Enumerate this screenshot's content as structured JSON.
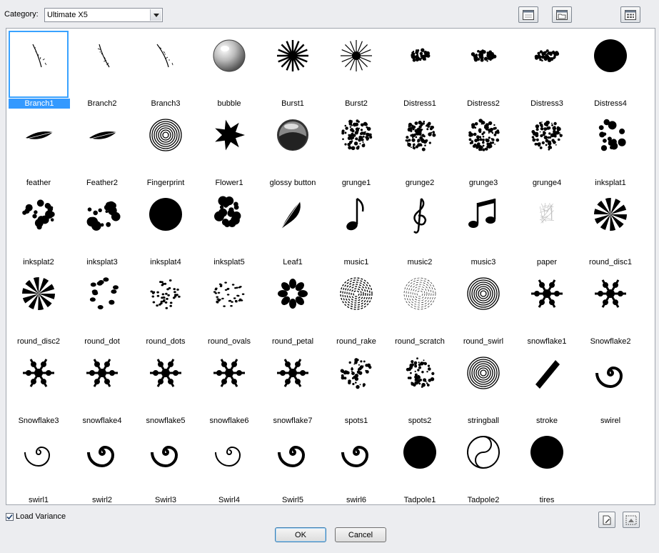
{
  "toolbar": {
    "category_label": "Category:",
    "category_value": "Ultimate X5"
  },
  "grid": {
    "items": [
      {
        "label": "Branch1",
        "icon": "branch-icon",
        "selected": true
      },
      {
        "label": "Branch2",
        "icon": "branch-icon"
      },
      {
        "label": "Branch3",
        "icon": "branch-icon"
      },
      {
        "label": "bubble",
        "icon": "bubble-icon"
      },
      {
        "label": "Burst1",
        "icon": "burst-icon"
      },
      {
        "label": "Burst2",
        "icon": "burst-icon"
      },
      {
        "label": "Distress1",
        "icon": "distress-icon"
      },
      {
        "label": "Distress2",
        "icon": "distress-icon"
      },
      {
        "label": "Distress3",
        "icon": "distress-icon"
      },
      {
        "label": "Distress4",
        "icon": "disc-icon"
      },
      {
        "label": "feather",
        "icon": "feather-icon"
      },
      {
        "label": "Feather2",
        "icon": "feather-icon"
      },
      {
        "label": "Fingerprint",
        "icon": "fingerprint-icon"
      },
      {
        "label": "Flower1",
        "icon": "star-icon"
      },
      {
        "label": "glossy button",
        "icon": "glossy-button-icon"
      },
      {
        "label": "grunge1",
        "icon": "grunge-icon"
      },
      {
        "label": "grunge2",
        "icon": "grunge-icon"
      },
      {
        "label": "grunge3",
        "icon": "grunge-icon"
      },
      {
        "label": "grunge4",
        "icon": "grunge-icon"
      },
      {
        "label": "inksplat1",
        "icon": "inksplat-icon"
      },
      {
        "label": "inksplat2",
        "icon": "inksplat-icon"
      },
      {
        "label": "inksplat3",
        "icon": "inksplat-icon"
      },
      {
        "label": "inksplat4",
        "icon": "disc-icon"
      },
      {
        "label": "inksplat5",
        "icon": "inksplat-icon"
      },
      {
        "label": "Leaf1",
        "icon": "leaf-icon"
      },
      {
        "label": "music1",
        "icon": "music-note-icon"
      },
      {
        "label": "music2",
        "icon": "treble-clef-icon"
      },
      {
        "label": "music3",
        "icon": "music-notes-icon"
      },
      {
        "label": "paper",
        "icon": "paper-icon"
      },
      {
        "label": "round_disc1",
        "icon": "round-disc-icon"
      },
      {
        "label": "round_disc2",
        "icon": "round-disc-icon"
      },
      {
        "label": "round_dot",
        "icon": "round-dot-icon"
      },
      {
        "label": "round_dots",
        "icon": "round-dots-icon"
      },
      {
        "label": "round_ovals",
        "icon": "round-ovals-icon"
      },
      {
        "label": "round_petal",
        "icon": "round-petal-icon"
      },
      {
        "label": "round_rake",
        "icon": "round-rake-icon"
      },
      {
        "label": "round_scratch",
        "icon": "round-scratch-icon"
      },
      {
        "label": "round_swirl",
        "icon": "round-swirl-icon"
      },
      {
        "label": "snowflake1",
        "icon": "snowflake-icon"
      },
      {
        "label": "Snowflake2",
        "icon": "snowflake-icon"
      },
      {
        "label": "Snowflake3",
        "icon": "snowflake-icon"
      },
      {
        "label": "snowflake4",
        "icon": "snowflake-icon"
      },
      {
        "label": "snowflake5",
        "icon": "snowflake-icon"
      },
      {
        "label": "snowflake6",
        "icon": "snowflake-icon"
      },
      {
        "label": "snowflake7",
        "icon": "snowflake-icon"
      },
      {
        "label": "spots1",
        "icon": "spots-icon"
      },
      {
        "label": "spots2",
        "icon": "spots-icon"
      },
      {
        "label": "stringball",
        "icon": "stringball-icon"
      },
      {
        "label": "stroke",
        "icon": "stroke-icon"
      },
      {
        "label": "swirel",
        "icon": "swirl-icon"
      },
      {
        "label": "swirl1",
        "icon": "swirl-icon"
      },
      {
        "label": "swirl2",
        "icon": "swirl-icon"
      },
      {
        "label": "Swirl3",
        "icon": "swirl-icon"
      },
      {
        "label": "Swirl4",
        "icon": "swirl-icon"
      },
      {
        "label": "Swirl5",
        "icon": "swirl-icon"
      },
      {
        "label": "swirl6",
        "icon": "swirl-icon"
      },
      {
        "label": "Tadpole1",
        "icon": "disc-icon"
      },
      {
        "label": "Tadpole2",
        "icon": "tadpole-icon"
      },
      {
        "label": "tires",
        "icon": "disc-icon"
      }
    ]
  },
  "footer": {
    "load_variance_label": "Load Variance",
    "load_variance_checked": true,
    "ok_label": "OK",
    "cancel_label": "Cancel"
  },
  "colors": {
    "selection": "#3399ff",
    "dialog_bg": "#ecedf0"
  }
}
